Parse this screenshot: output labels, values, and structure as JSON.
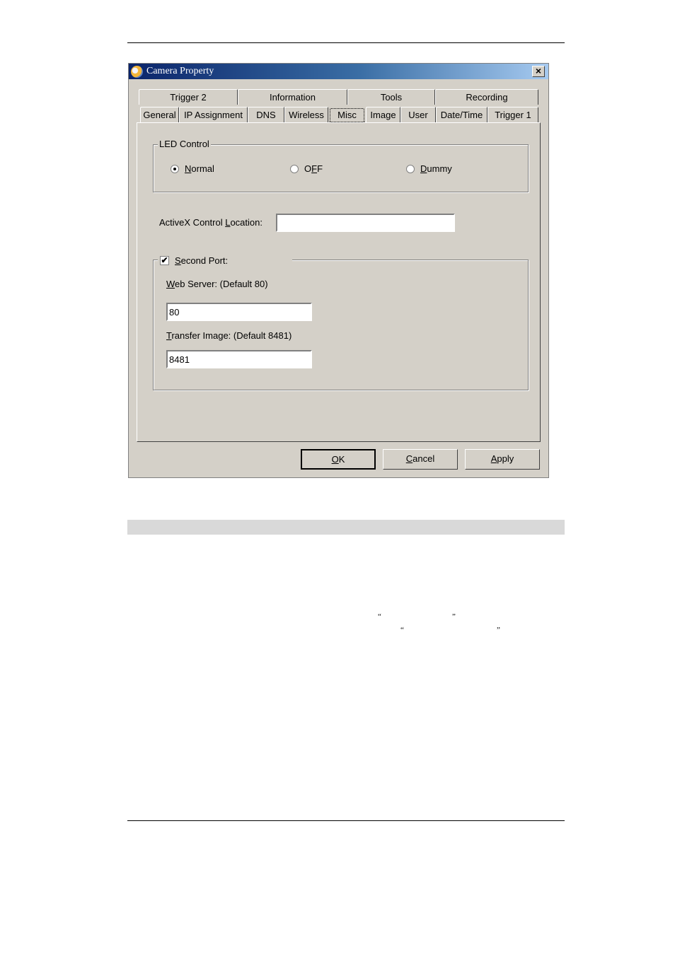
{
  "dialog": {
    "title": "Camera Property",
    "close_label": "×",
    "tabs_row_back": [
      {
        "label": "Trigger 2"
      },
      {
        "label": "Information"
      },
      {
        "label": "Tools"
      },
      {
        "label": "Recording"
      }
    ],
    "tabs_row_front": [
      {
        "label": "General"
      },
      {
        "label": "IP Assignment"
      },
      {
        "label": "DNS"
      },
      {
        "label": "Wireless"
      },
      {
        "label": "Misc",
        "active": true
      },
      {
        "label": "Image"
      },
      {
        "label": "User"
      },
      {
        "label": "Date/Time"
      },
      {
        "label": "Trigger 1"
      }
    ],
    "led_control": {
      "title": "LED Control",
      "options": [
        {
          "label_access": "N",
          "label_rest": "ormal",
          "checked": true
        },
        {
          "label_pre": "O",
          "label_access": "F",
          "label_rest": "F",
          "checked": false
        },
        {
          "label_access": "D",
          "label_rest": "ummy",
          "checked": false
        }
      ]
    },
    "activex": {
      "label_pre": "ActiveX Control ",
      "label_access": "L",
      "label_rest": "ocation:",
      "value": ""
    },
    "second_port": {
      "checked": true,
      "check_glyph": "✔",
      "label_access": "S",
      "label_rest": "econd Port:",
      "web_server": {
        "label_access": "W",
        "label_rest": "eb Server: (Default 80)",
        "value": "80"
      },
      "transfer_image": {
        "label_access": "T",
        "label_rest": "ransfer Image: (Default 8481)",
        "value": "8481"
      }
    },
    "buttons": {
      "ok": {
        "access": "O",
        "rest": "K"
      },
      "cancel": {
        "access": "C",
        "rest": "ancel"
      },
      "apply": {
        "access": "A",
        "rest": "pply"
      }
    }
  },
  "document": {
    "open_quote": "“",
    "close_quote": "”"
  }
}
